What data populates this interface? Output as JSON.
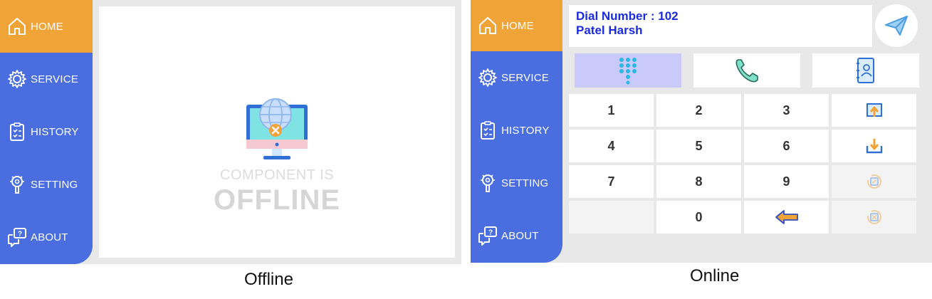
{
  "nav_labels": {
    "home": "HOME",
    "service": "SERVICE",
    "history": "HISTORY",
    "setting": "SETTING",
    "about": "ABOUT"
  },
  "offline_panel": {
    "active_nav": "home",
    "message_line1": "COMPONENT IS",
    "message_line2": "OFFLINE",
    "caption": "Offline"
  },
  "online_panel": {
    "active_nav": "home",
    "dial_number_label": "Dial Number : 102",
    "contact_name": "Patel Harsh",
    "mode_buttons": [
      {
        "name": "dialpad-icon",
        "selected": true
      },
      {
        "name": "phone-icon",
        "selected": false
      },
      {
        "name": "contacts-book-icon",
        "selected": false
      }
    ],
    "keypad": {
      "row1": [
        "1",
        "2",
        "3"
      ],
      "row2": [
        "4",
        "5",
        "6"
      ],
      "row3": [
        "7",
        "8",
        "9"
      ],
      "row4": [
        "",
        "0"
      ]
    },
    "side_actions": [
      {
        "icon": "upload-icon",
        "enabled": true
      },
      {
        "icon": "download-icon",
        "enabled": true
      },
      {
        "icon": "transfer-icon",
        "enabled": false
      },
      {
        "icon": "cancel-transfer-icon",
        "enabled": false
      }
    ],
    "caption": "Online"
  },
  "colors": {
    "sidebar": "#4a6ee0",
    "active_nav": "#f0a336",
    "dial_text": "#1a2be0",
    "selected_mode": "#c9cafa",
    "panel_bg": "#e8e8e8"
  }
}
